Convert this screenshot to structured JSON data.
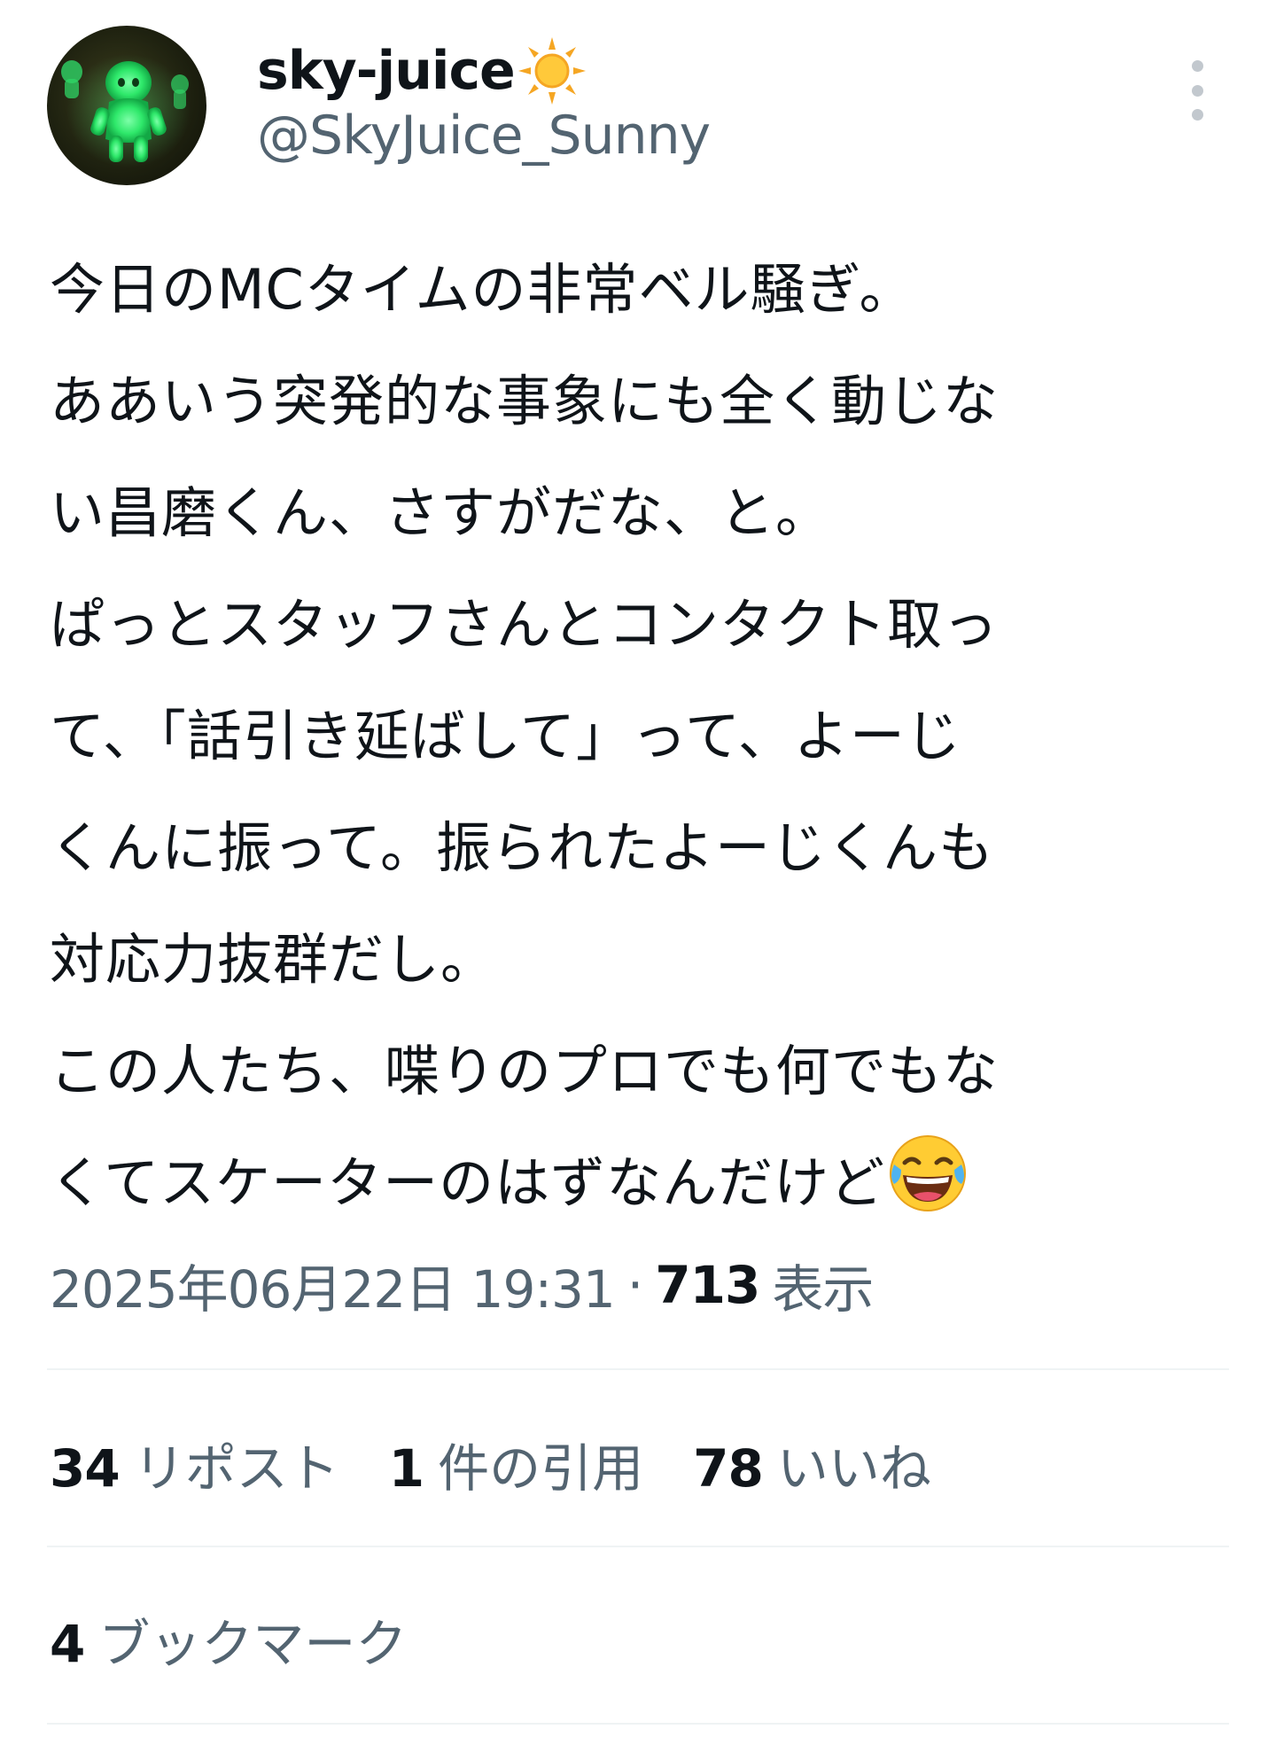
{
  "author": {
    "display_name": "sky-juice",
    "handle": "@SkyJuice_Sunny",
    "name_emoji": "sun-icon",
    "avatar": "avatar"
  },
  "tweet": {
    "lines": [
      "今日のMCタイムの非常ベル騒ぎ。",
      "ああいう突発的な事象にも全く動じな",
      "い昌磨くん、さすがだな、と。",
      "ぱっとスタッフさんとコンタクト取っ",
      "て、「話引き延ばして」って、よーじ",
      "くんに振って。振られたよーじくんも",
      "対応力抜群だし。",
      "この人たち、喋りのプロでも何でもな",
      "くてスケーターのはずなんだけど"
    ],
    "trailing_emoji": "face-with-tears-of-joy-icon"
  },
  "meta": {
    "timestamp": "2025年06月22日 19:31",
    "separator": "·",
    "views_count": "713",
    "views_label": "表示"
  },
  "stats": {
    "reposts_count": "34",
    "reposts_label": "リポスト",
    "quotes_count": "1",
    "quotes_label": "件の引用",
    "likes_count": "78",
    "likes_label": "いいね",
    "bookmarks_count": "4",
    "bookmarks_label": "ブックマーク"
  },
  "colors": {
    "text_primary": "#0f1419",
    "text_secondary": "#536471",
    "divider": "#eff3f4",
    "avatar_glow": "#3df07a"
  }
}
